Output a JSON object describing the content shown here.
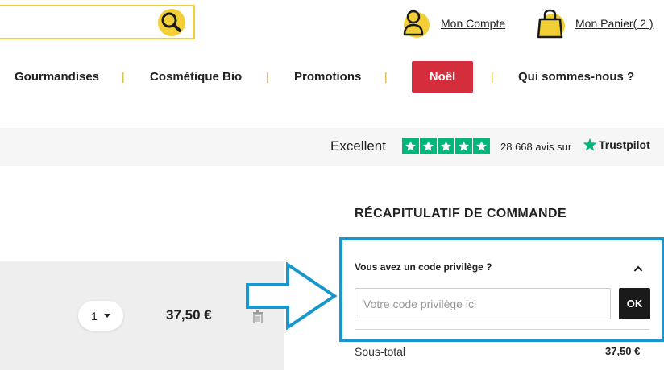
{
  "header": {
    "search": {
      "placeholder": "",
      "value": ""
    },
    "account_label": "Mon Compte",
    "cart_label": "Mon Panier",
    "cart_count": "( 2 )"
  },
  "nav": {
    "items": [
      "Gourmandises",
      "Cosmétique Bio",
      "Promotions",
      "Noël",
      "Qui sommes-nous ?"
    ],
    "separator": "|"
  },
  "trustpilot": {
    "rating_text": "Excellent",
    "stars": 5,
    "reviews_text": "28 668 avis sur",
    "brand": "Trustpilot"
  },
  "cart_item": {
    "quantity": "1",
    "price": "37,50 €"
  },
  "summary": {
    "title": "RÉCAPITULATIF DE COMMANDE",
    "promo_question": "Vous avez un code privilège ?",
    "promo_placeholder": "Votre code privilège ici",
    "promo_button": "OK",
    "subtotal_label": "Sous-total",
    "subtotal_value": "37,50 €"
  },
  "colors": {
    "accent_yellow": "#f2cf34",
    "noel_red": "#d42e3c",
    "trustpilot_green": "#00b67a",
    "highlight_blue": "#1897cf"
  }
}
